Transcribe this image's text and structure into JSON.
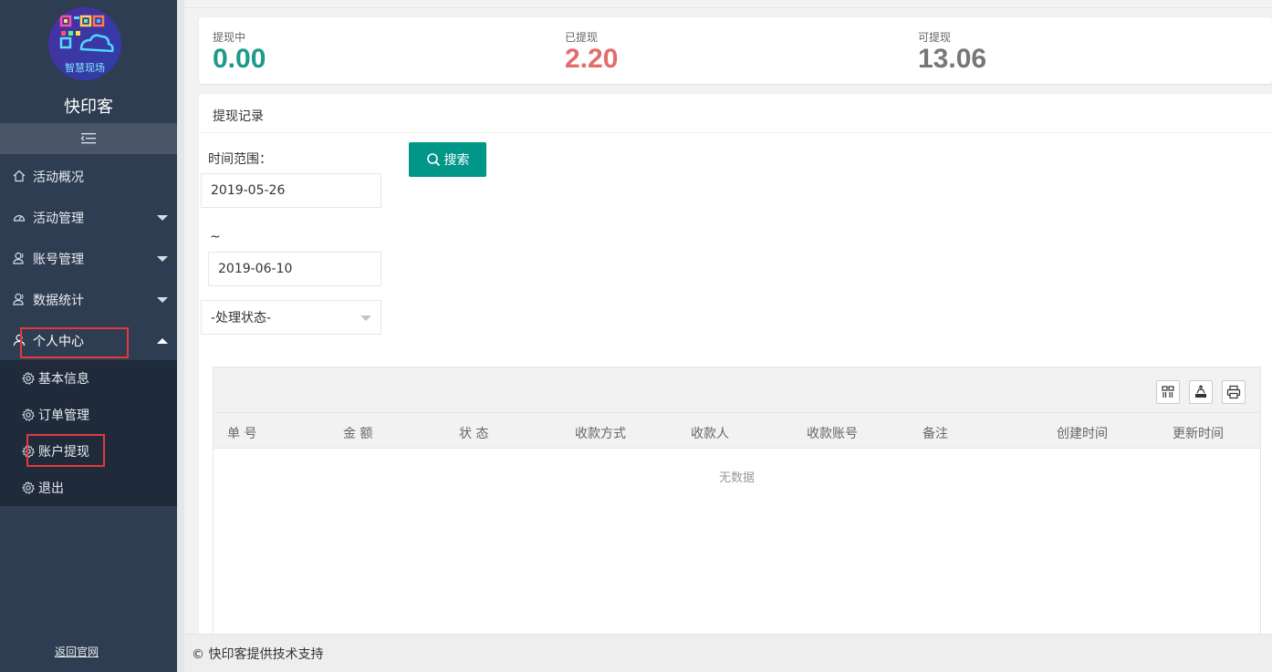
{
  "sidebar": {
    "logo_text": "智慧现场",
    "brand": "快印客",
    "menu": [
      {
        "label": "活动概况",
        "icon": "home-icon"
      },
      {
        "label": "活动管理",
        "icon": "dashboard-icon"
      },
      {
        "label": "账号管理",
        "icon": "user-icon"
      },
      {
        "label": "数据统计",
        "icon": "user-icon"
      },
      {
        "label": "个人中心",
        "icon": "person-icon"
      }
    ],
    "submenu": [
      {
        "label": "基本信息"
      },
      {
        "label": "订单管理"
      },
      {
        "label": "账户提现"
      },
      {
        "label": "退出"
      }
    ],
    "back_link": "返回官网"
  },
  "stats": {
    "pending_label": "提现中",
    "pending_value": "0.00",
    "done_label": "已提现",
    "done_value": "2.20",
    "available_label": "可提现",
    "available_value": "13.06",
    "colors": {
      "pending": "#1e9a8a",
      "done": "#e36d6d",
      "available": "#777777"
    }
  },
  "panel": {
    "title": "提现记录",
    "time_range_label": "时间范围：",
    "start_date": "2019-05-26",
    "tilde": "~",
    "end_date": "2019-06-10",
    "status_select": "-处理状态-",
    "search_label": "搜索"
  },
  "table": {
    "columns": [
      "单 号",
      "金 额",
      "状 态",
      "收款方式",
      "收款人",
      "收款账号",
      "备注",
      "创建时间",
      "更新时间"
    ],
    "empty_text": "无数据"
  },
  "footer": {
    "text": "© 快印客提供技术支持"
  }
}
